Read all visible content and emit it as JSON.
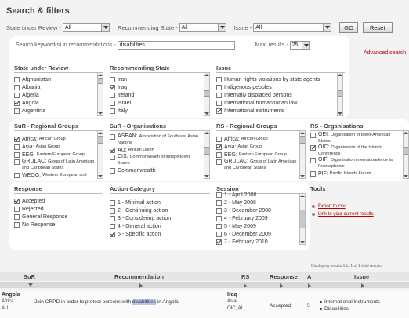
{
  "header": {
    "title": "Search & filters"
  },
  "filters": {
    "sur_label": "State under Review -",
    "sur_value": "All",
    "rec_label": "Recommending State -",
    "rec_value": "All",
    "issue_label": "Issue -",
    "issue_value": "All",
    "go_label": "GO",
    "reset_label": "Reset"
  },
  "keyword": {
    "label": "Search keyword(s) in recommendations -",
    "value": "disabilities",
    "max_label": "Max. results -",
    "max_value": "25"
  },
  "advanced_link": "Advanced search",
  "state_under_review": {
    "title": "State under Review",
    "items": [
      {
        "label": "Afghanistan",
        "checked": false
      },
      {
        "label": "Albania",
        "checked": false
      },
      {
        "label": "Algeria",
        "checked": false
      },
      {
        "label": "Angola",
        "checked": true
      },
      {
        "label": "Argentina",
        "checked": false
      }
    ]
  },
  "recommending_state": {
    "title": "Recommending State",
    "items": [
      {
        "label": "Iran",
        "checked": false
      },
      {
        "label": "Iraq",
        "checked": true
      },
      {
        "label": "Ireland",
        "checked": false
      },
      {
        "label": "Israel",
        "checked": false
      },
      {
        "label": "Italy",
        "checked": false
      }
    ]
  },
  "issue": {
    "title": "Issue",
    "items": [
      {
        "label": "Human rights violations by state agents",
        "checked": false
      },
      {
        "label": "Indigenous peoples",
        "checked": false
      },
      {
        "label": "Internally displaced persons",
        "checked": false
      },
      {
        "label": "International humanitarian law",
        "checked": false
      },
      {
        "label": "International instruments",
        "checked": true
      }
    ]
  },
  "sur_groups": {
    "title": "SuR - Regional Groups",
    "items": [
      {
        "label": "Africa:",
        "sub": "African Group",
        "checked": true
      },
      {
        "label": "Asia:",
        "sub": "Asian Group",
        "checked": false
      },
      {
        "label": "EEG:",
        "sub": "Eastern European Group",
        "checked": false
      },
      {
        "label": "GRULAC:",
        "sub": "Group of Latin American and Caribbean States",
        "checked": false
      },
      {
        "label": "WEOG:",
        "sub": "Western European and",
        "checked": false
      }
    ]
  },
  "sur_orgs": {
    "title": "SuR - Organisations",
    "items": [
      {
        "label": "ASEAN:",
        "sub": "Association of Southeast Asian Nations",
        "checked": false
      },
      {
        "label": "AU:",
        "sub": "African Union",
        "checked": true
      },
      {
        "label": "CIS:",
        "sub": "Commonwealth of Independent States",
        "checked": false
      },
      {
        "label": "Commonwealth",
        "sub": "",
        "checked": false
      }
    ]
  },
  "rs_groups": {
    "title": "RS - Regional Groups",
    "items": [
      {
        "label": "Africa:",
        "sub": "African Group",
        "checked": false
      },
      {
        "label": "Asia:",
        "sub": "Asian Group",
        "checked": true
      },
      {
        "label": "EEG:",
        "sub": "Eastern European Group",
        "checked": false
      },
      {
        "label": "GRULAC:",
        "sub": "Group of Latin American and Caribbean States",
        "checked": false
      }
    ]
  },
  "rs_orgs": {
    "title": "RS - Organisations",
    "items": [
      {
        "label": "OEI:",
        "sub": "Organisation of Ibero-American States",
        "checked": false
      },
      {
        "label": "OIC:",
        "sub": "Organisation of the Islamic Conference",
        "checked": true
      },
      {
        "label": "OIF:",
        "sub": "Organisation internationale de la Francophonie",
        "checked": false
      },
      {
        "label": "PIF:",
        "sub": "Pacific Islands Forum",
        "checked": false
      }
    ]
  },
  "response": {
    "title": "Response",
    "items": [
      {
        "label": "Accepted",
        "checked": true
      },
      {
        "label": "Rejected",
        "checked": false
      },
      {
        "label": "General Response",
        "checked": false
      },
      {
        "label": "No Response",
        "checked": false
      }
    ]
  },
  "action_category": {
    "title": "Action Category",
    "items": [
      {
        "label": "1 - Minimal action",
        "checked": false
      },
      {
        "label": "2 - Continuing action",
        "checked": false
      },
      {
        "label": "3 - Considering action",
        "checked": false
      },
      {
        "label": "4 - General action",
        "checked": false
      },
      {
        "label": "5 - Specific action",
        "checked": true
      }
    ]
  },
  "session": {
    "title": "Session",
    "items": [
      {
        "label": "1 - April 2008",
        "checked": false
      },
      {
        "label": "2 - May 2008",
        "checked": false
      },
      {
        "label": "3 - December 2008",
        "checked": false
      },
      {
        "label": "4 - February 2009",
        "checked": false
      },
      {
        "label": "5 - May 2009",
        "checked": false
      },
      {
        "label": "6 - December 2009",
        "checked": false
      },
      {
        "label": "7 - February 2010",
        "checked": true
      }
    ]
  },
  "tools": {
    "title": "Tools",
    "export_label": "Export to csv",
    "link_label": "Link to your current results"
  },
  "results": {
    "display_text": "Displaying results 1 to 1 of 1 total results",
    "columns": {
      "sur": "SuR",
      "recommendation": "Recommendation",
      "rs": "RS",
      "response": "Response",
      "a": "A",
      "issue": "Issue"
    },
    "row": {
      "sur_name": "Angola",
      "sur_region": "Africa",
      "sur_org": "AU",
      "rec_before": "Join CRPD in order to protect persons with",
      "rec_highlight": "disabilities",
      "rec_after": "in Angola",
      "rs_name": "Iraq",
      "rs_region": "Asia",
      "rs_org": "OIC, AL,",
      "response": "Accepted",
      "action": "5",
      "issue_1": "International instruments",
      "issue_2": "Disabilities"
    }
  }
}
